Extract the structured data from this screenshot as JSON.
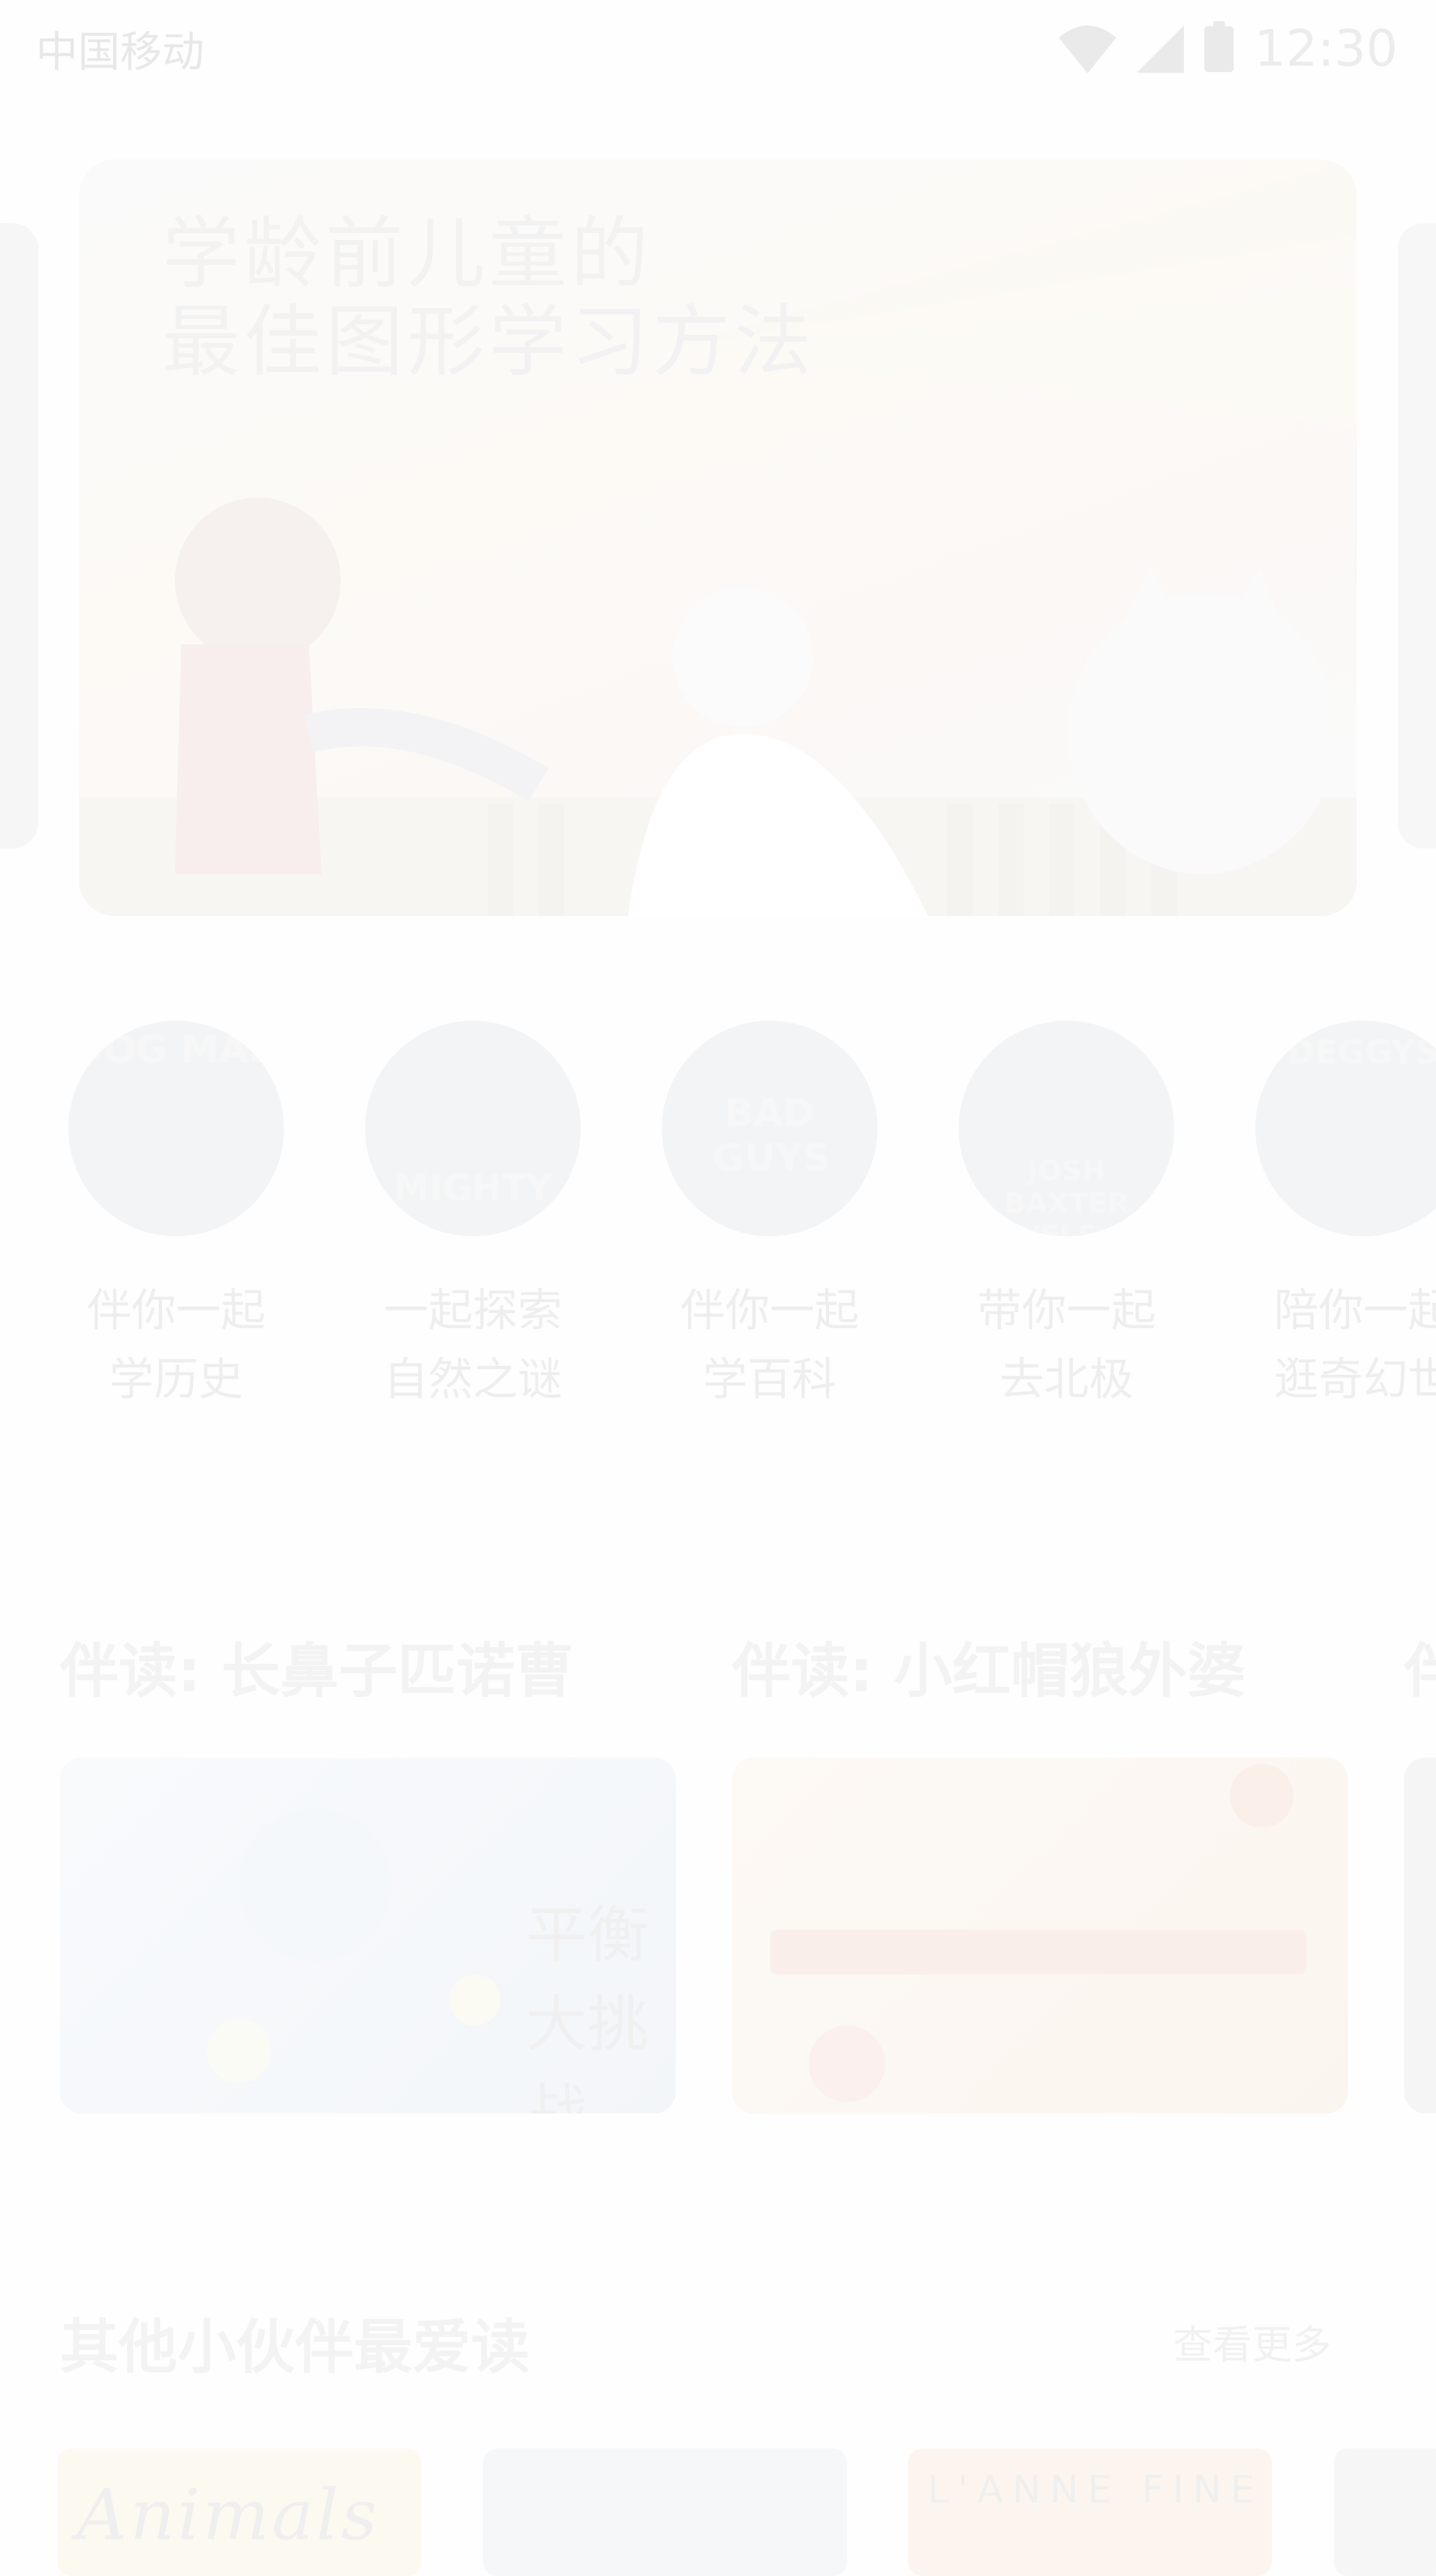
{
  "status_bar": {
    "carrier": "中国移动",
    "time": "12:30"
  },
  "banner": {
    "title": "学龄前儿童的\n最佳图形学习方法"
  },
  "characters": [
    {
      "logo": "DOG MAN",
      "label": "伴你一起\n学历史"
    },
    {
      "logo": "MIGHTY",
      "label": "一起探索\n自然之谜"
    },
    {
      "logo": "BAD GUYS",
      "label": "伴你一起\n学百科"
    },
    {
      "logo": "JOSH BAXTER LEVELS UP",
      "label": "带你一起\n去北极"
    },
    {
      "logo": "DEGGYS",
      "label": "陪你一起\n逛奇幻世"
    }
  ],
  "read_along": {
    "items": [
      {
        "title": "伴读: 长鼻子匹诺曹",
        "caption_1": "平衡",
        "caption_2": "大挑战"
      },
      {
        "title": "伴读: 小红帽狼外婆"
      },
      {
        "title": "伴"
      }
    ]
  },
  "favorites": {
    "title": "其他小伙伴最爱读",
    "more": "查看更多",
    "books": [
      {
        "title": "Animals"
      },
      {
        "title": ""
      },
      {
        "title": "L'ANNE FINE"
      },
      {
        "title": ""
      }
    ]
  },
  "colors": {
    "background": "#fefefe",
    "text_faded": "#eeeeee",
    "heading_faded": "#f3f3f3"
  }
}
